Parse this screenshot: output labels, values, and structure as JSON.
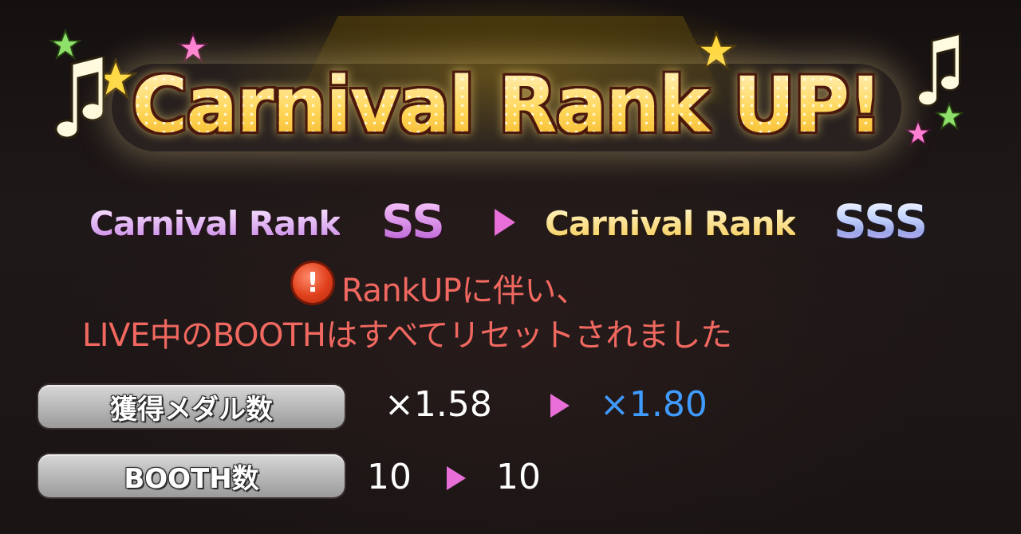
{
  "title": "Carnival Rank UP!",
  "rank_change": {
    "prefix_old": "Carnival Rank",
    "old_rank": "SS",
    "prefix_new": "Carnival Rank",
    "new_rank": "SSS"
  },
  "notice": {
    "line1": "RankUPに伴い、",
    "line2": "LIVE中のBOOTHはすべてリセットされました"
  },
  "stats": [
    {
      "label": "獲得メダル数",
      "old": "×1.58",
      "new": "×1.80"
    },
    {
      "label": "BOOTH数",
      "old": "10",
      "new": "10"
    }
  ],
  "colors": {
    "notice": "#f06860",
    "arrow": "#e86fd7",
    "new_value": "#3f9bff",
    "title_gold": "#ffd75a"
  },
  "icons": {
    "warning": "warning-icon",
    "music_note": "music-note-icon",
    "star": "star-icon"
  }
}
